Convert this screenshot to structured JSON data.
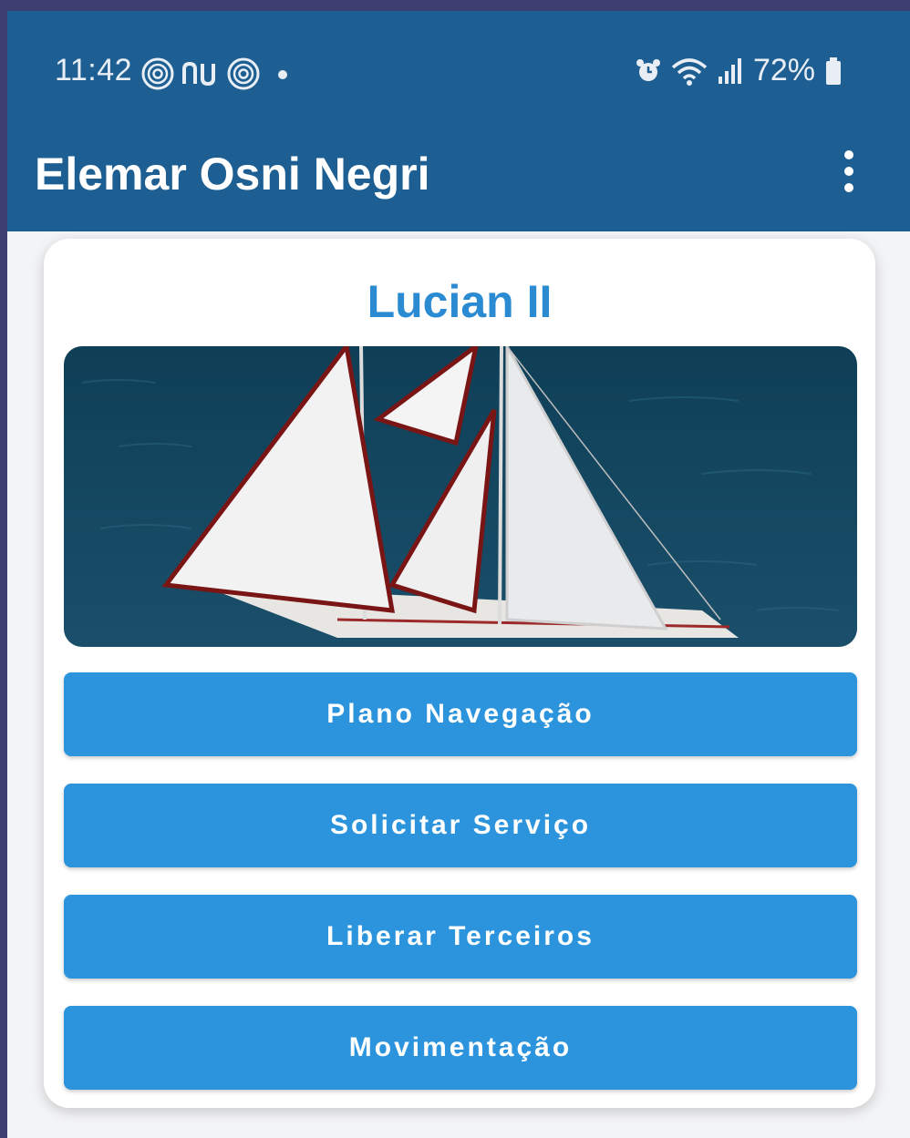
{
  "status_bar": {
    "time": "11:42",
    "left_icons": [
      "fingerprint-icon",
      "nubank-icon",
      "fingerprint-icon",
      "notification-dot-icon"
    ],
    "right_icons": [
      "alarm-icon",
      "wifi-icon",
      "signal-icon"
    ],
    "battery_percent": "72%"
  },
  "app_bar": {
    "title": "Elemar Osni Negri",
    "menu_icon": "more-vert-icon"
  },
  "card": {
    "title": "Lucian II",
    "image": "sailboat-photo",
    "buttons": [
      {
        "label": "Plano Navegação"
      },
      {
        "label": "Solicitar Serviço"
      },
      {
        "label": "Liberar Terceiros"
      },
      {
        "label": "Movimentação"
      }
    ]
  },
  "colors": {
    "app_bar": "#1d5f92",
    "accent": "#2a8bd2",
    "button": "#2b94dd",
    "background": "#f3f4f6"
  }
}
